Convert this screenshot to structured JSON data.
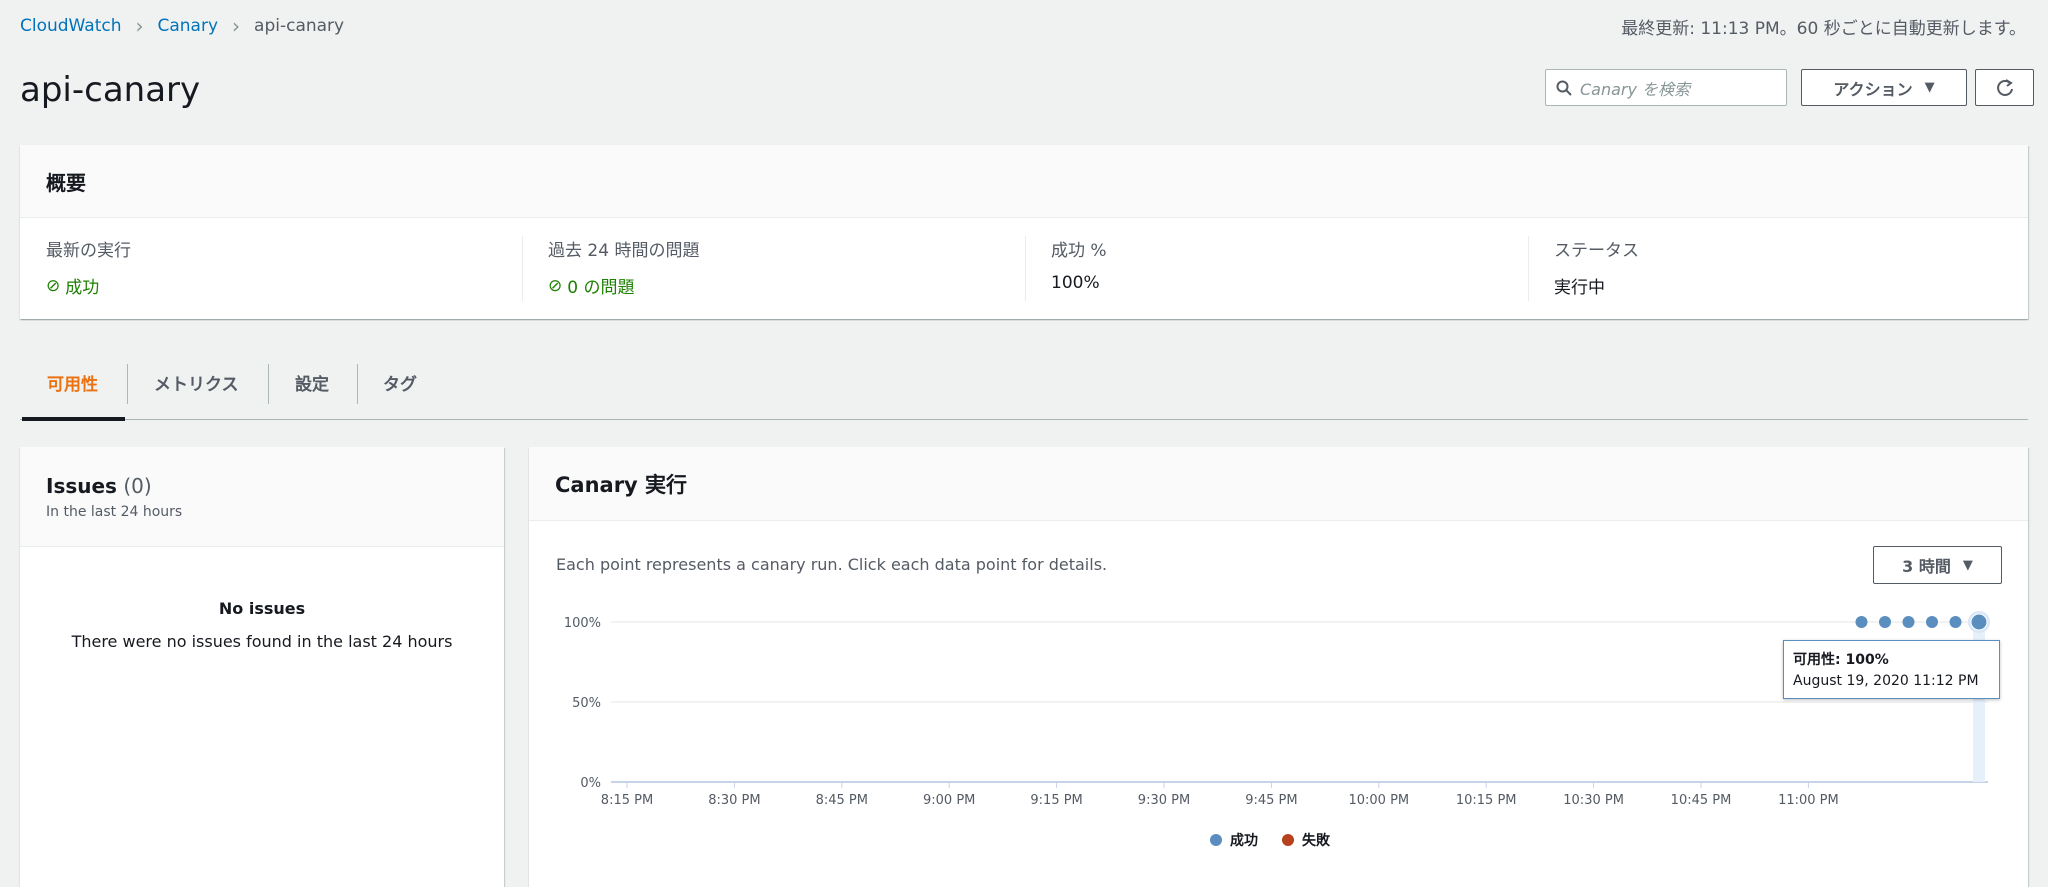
{
  "breadcrumb": [
    "CloudWatch",
    "Canary",
    "api-canary"
  ],
  "last_updated": "最終更新: 11:13 PM。60 秒ごとに自動更新します。",
  "title": "api-canary",
  "search": {
    "placeholder": "Canary を検索"
  },
  "actions_label": "アクション",
  "overview": {
    "title": "概要",
    "columns": [
      {
        "label": "最新の実行",
        "value": "成功",
        "status": "ok"
      },
      {
        "label": "過去 24 時間の問題",
        "value": "0 の問題",
        "status": "ok"
      },
      {
        "label": "成功 %",
        "value": "100%"
      },
      {
        "label": "ステータス",
        "value": "実行中"
      }
    ]
  },
  "tabs": [
    "可用性",
    "メトリクス",
    "設定",
    "タグ"
  ],
  "issues": {
    "title": "Issues",
    "count": "(0)",
    "subtitle": "In the last 24 hours",
    "empty_title": "No issues",
    "empty_text": "There were no issues found in the last 24 hours"
  },
  "runs": {
    "title": "Canary 実行",
    "description": "Each point represents a canary run. Click each data point for details.",
    "range_label": "3 時間"
  },
  "chart_data": {
    "type": "scatter",
    "y_ticks": [
      "100%",
      "50%",
      "0%"
    ],
    "ylim": [
      0,
      100
    ],
    "x_ticks": [
      "8:15 PM",
      "8:30 PM",
      "8:45 PM",
      "9:00 PM",
      "9:15 PM",
      "9:30 PM",
      "9:45 PM",
      "10:00 PM",
      "10:15 PM",
      "10:30 PM",
      "10:45 PM",
      "11:00 PM"
    ],
    "series": [
      {
        "name": "成功",
        "color": "#5a8ebf",
        "values": [
          100,
          100,
          100,
          100,
          100,
          100
        ]
      },
      {
        "name": "失敗",
        "color": "#b7411c",
        "values": []
      }
    ],
    "tooltip": {
      "title": "可用性: 100%",
      "time": "August 19, 2020 11:12 PM"
    }
  }
}
